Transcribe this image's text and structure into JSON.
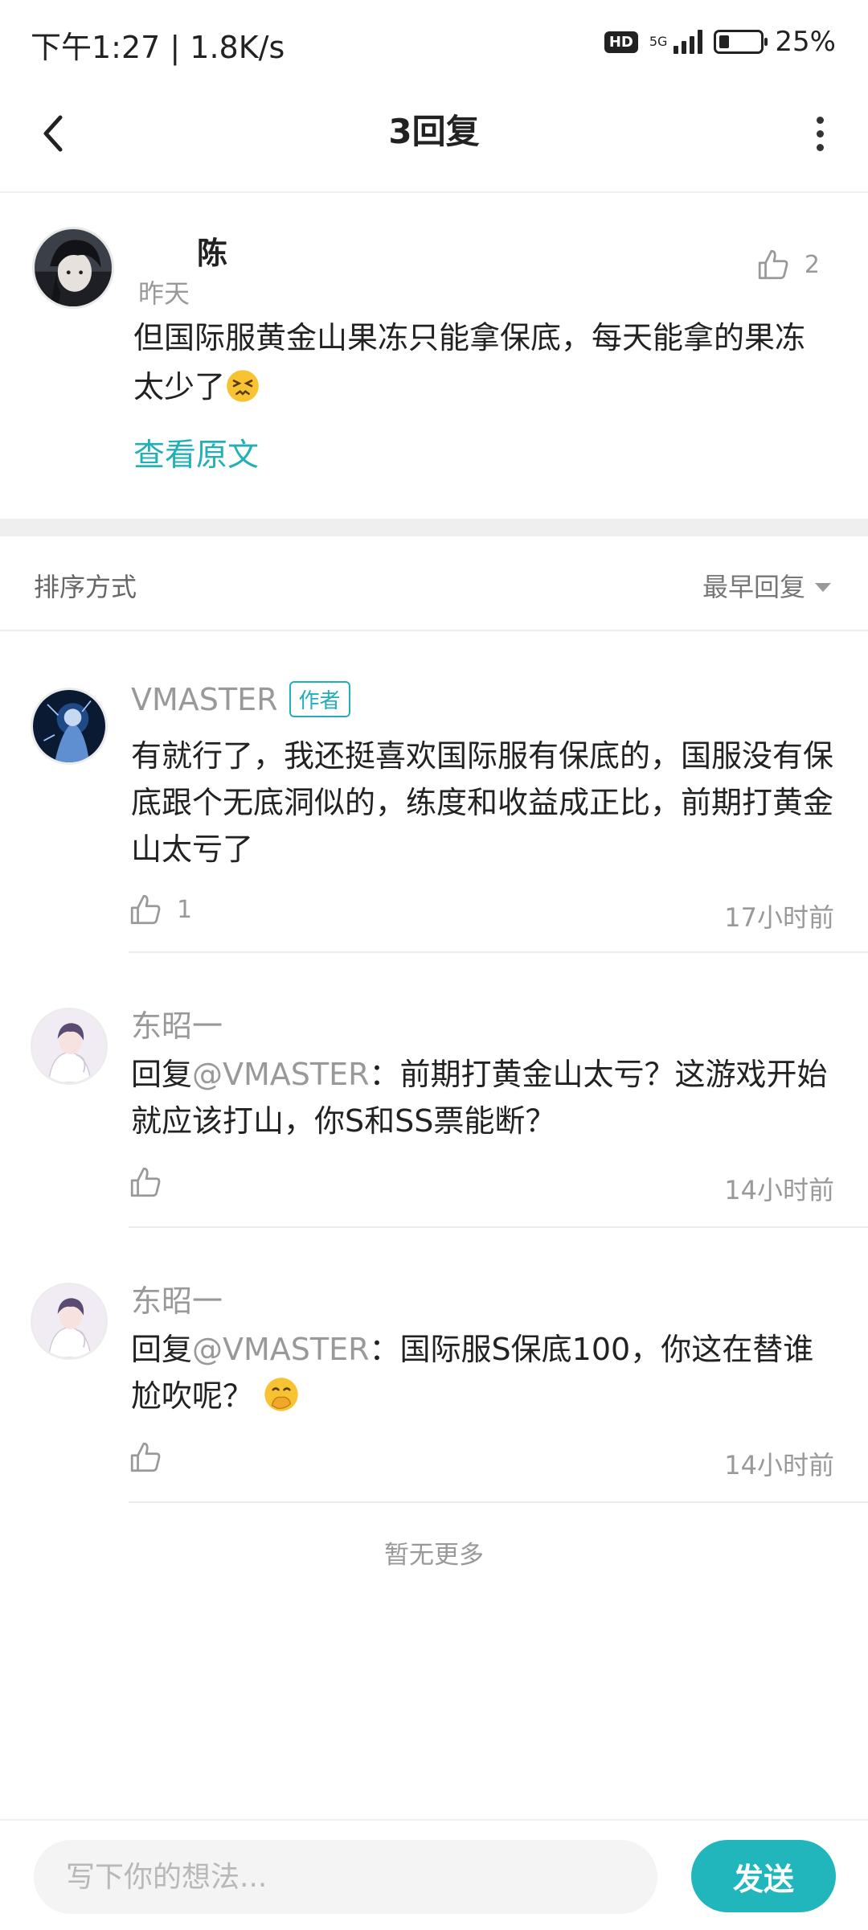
{
  "status_bar": {
    "time": "下午1:27 | 1.8K/s",
    "hd": "HD",
    "network": "5G",
    "battery_percent": "25%",
    "battery_level": 0.25
  },
  "header": {
    "title": "3回复",
    "back_icon": "back-arrow-icon",
    "more_icon": "more-vertical-icon"
  },
  "original_comment": {
    "author": "陈",
    "time": "昨天",
    "likes": "2",
    "text": "但国际服黄金山果冻只能拿保底，每天能拿的果冻太少了",
    "emoji": "persevering-face",
    "view_original_label": "查看原文"
  },
  "sort": {
    "label": "排序方式",
    "selected": "最早回复"
  },
  "replies": [
    {
      "author": "VMASTER",
      "author_tag": "作者",
      "text": "有就行了，我还挺喜欢国际服有保底的，国服没有保底跟个无底洞似的，练度和收益成正比，前期打黄金山太亏了",
      "likes": "1",
      "time": "17小时前"
    },
    {
      "author": "东昭一",
      "reply_prefix": "回复",
      "mention": "@VMASTER",
      "text": "：前期打黄金山太亏？这游戏开始就应该打山，你S和SS票能断？",
      "likes": "",
      "time": "14小时前"
    },
    {
      "author": "东昭一",
      "reply_prefix": "回复",
      "mention": "@VMASTER",
      "text": "：国际服S保底100，你这在替谁尬吹呢？",
      "emoji": "hand-over-mouth-face",
      "likes": "",
      "time": "14小时前"
    }
  ],
  "no_more_label": "暂无更多",
  "composer": {
    "placeholder": "写下你的想法...",
    "send_label": "发送"
  },
  "colors": {
    "accent": "#21b6bb",
    "muted_text": "#999999",
    "divider": "#ececec"
  }
}
